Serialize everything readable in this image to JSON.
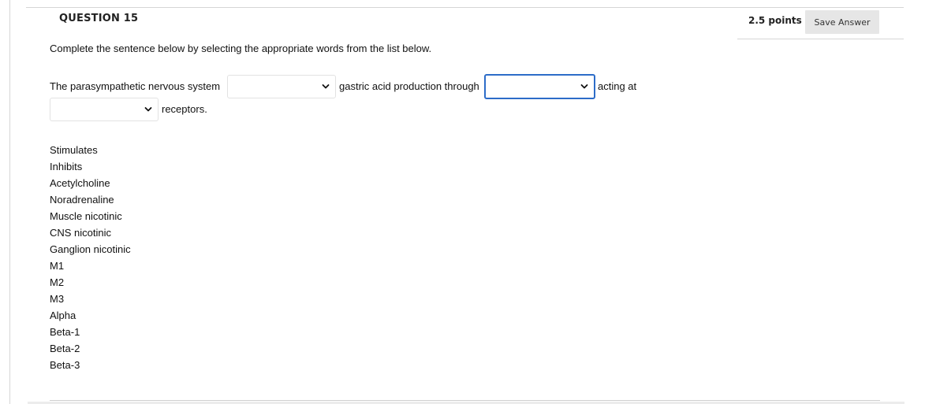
{
  "question": {
    "title": "QUESTION 15",
    "points": "2.5 points",
    "save_label": "Save Answer",
    "instruction": "Complete the sentence below by selecting the appropriate words from the list below."
  },
  "sentence": {
    "part1": "The parasympathetic nervous system",
    "part2": "gastric acid production through",
    "part3": "acting at",
    "part4": "receptors."
  },
  "selects": [
    {
      "value": ""
    },
    {
      "value": ""
    },
    {
      "value": ""
    }
  ],
  "word_list": [
    "Stimulates",
    "Inhibits",
    "Acetylcholine",
    "Noradrenaline",
    "Muscle nicotinic",
    "CNS nicotinic",
    "Ganglion nicotinic",
    "M1",
    "M2",
    "M3",
    "Alpha",
    "Beta-1",
    "Beta-2",
    "Beta-3"
  ],
  "colors": {
    "focus": "#2d6cc8",
    "button_bg": "#e6e6e6"
  },
  "icons": {
    "select_arrow": "chevron-down-icon"
  }
}
